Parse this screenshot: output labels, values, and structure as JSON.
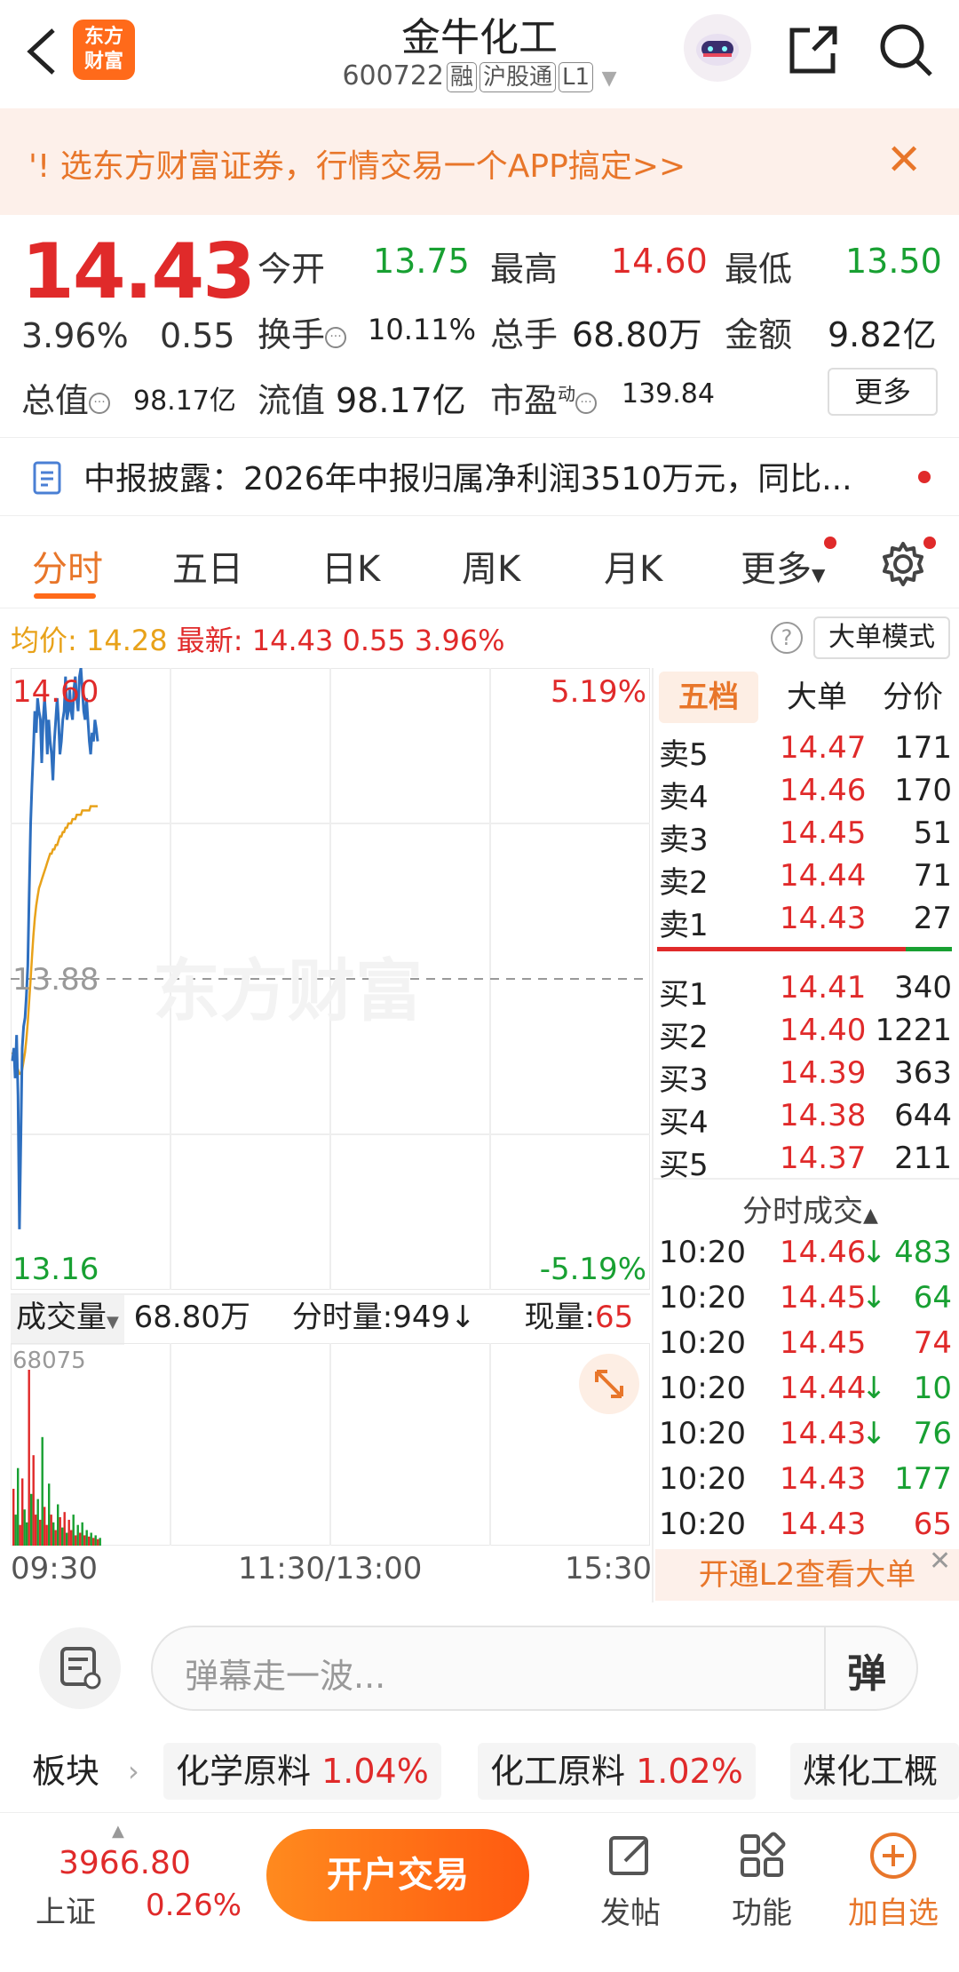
{
  "header": {
    "logo_text_1": "东方",
    "logo_text_2": "财富",
    "title": "金牛化工",
    "code": "600722",
    "tags": [
      "融",
      "沪股通",
      "L1"
    ]
  },
  "banner": {
    "text": "选东方财富证券，行情交易一个APP搞定>>",
    "prefix": "'!"
  },
  "quote": {
    "price": "14.43",
    "change_pct": "3.96%",
    "change": "0.55",
    "open_label": "今开",
    "open": "13.75",
    "high_label": "最高",
    "high": "14.60",
    "low_label": "最低",
    "low": "13.50",
    "turnover_label": "换手",
    "turnover": "10.11%",
    "volume_label": "总手",
    "volume": "68.80万",
    "amount_label": "金额",
    "amount": "9.82亿",
    "mktcap_label": "总值",
    "mktcap": "98.17亿",
    "float_label": "流值",
    "float": "98.17亿",
    "pe_label": "市盈",
    "pe_sup": "动",
    "pe": "139.84",
    "more": "更多"
  },
  "report": {
    "text": "中报披露：2026年中报归属净利润3510万元，同比..."
  },
  "tabs": [
    "分时",
    "五日",
    "日K",
    "周K",
    "月K",
    "更多"
  ],
  "infobar": {
    "avg_label": "均价:",
    "avg": "14.28",
    "latest_label": "最新:",
    "latest": "14.43",
    "chg": "0.55",
    "pct": "3.96%",
    "bigmode": "大单模式"
  },
  "chart": {
    "top_price": "14.60",
    "mid_price": "13.88",
    "bottom_price": "13.16",
    "top_pct": "5.19%",
    "bottom_pct": "-5.19%",
    "watermark": "东方财富",
    "time_labels": [
      "09:30",
      "11:30/13:00",
      "15:30"
    ]
  },
  "chart_data": {
    "type": "line",
    "title": "",
    "series": [
      {
        "values": [
          13.69,
          13.72,
          13.65,
          13.75,
          13.61,
          13.3,
          13.5,
          13.72,
          13.77,
          13.79,
          13.84,
          13.91,
          14.08,
          14.24,
          14.33,
          14.41,
          14.5,
          14.45,
          14.53,
          14.5,
          14.48,
          14.38,
          14.48,
          14.53,
          14.48,
          14.4,
          14.48,
          14.43,
          14.4,
          14.34,
          14.43,
          14.48,
          14.53,
          14.48,
          14.4,
          14.43,
          14.48,
          14.5,
          14.58,
          14.48,
          14.5,
          14.55,
          14.5,
          14.48,
          14.55,
          14.58,
          14.53,
          14.5,
          14.58,
          14.6,
          14.55,
          14.5,
          14.48,
          14.53,
          14.48,
          14.43,
          14.4,
          14.45,
          14.43,
          14.48,
          14.46,
          14.43
        ]
      },
      {
        "values": [
          13.71,
          13.7,
          13.69,
          13.68,
          13.67,
          13.66,
          13.66,
          13.67,
          13.69,
          13.71,
          13.74,
          13.78,
          13.83,
          13.88,
          13.93,
          13.98,
          14.02,
          14.05,
          14.07,
          14.09,
          14.1,
          14.11,
          14.12,
          14.13,
          14.14,
          14.15,
          14.16,
          14.17,
          14.17,
          14.18,
          14.18,
          14.19,
          14.19,
          14.2,
          14.21,
          14.21,
          14.22,
          14.22,
          14.23,
          14.23,
          14.24,
          14.24,
          14.24,
          14.25,
          14.25,
          14.25,
          14.26,
          14.26,
          14.26,
          14.26,
          14.27,
          14.27,
          14.27,
          14.27,
          14.27,
          14.27,
          14.28,
          14.28,
          14.28,
          14.28,
          14.28,
          14.28
        ]
      }
    ],
    "ylim": [
      13.16,
      14.6
    ],
    "volume": {
      "label": "成交量",
      "total": "68.80万",
      "tick_label": "分时量:949",
      "current_label": "现量:",
      "current": "65",
      "max_label": "68075",
      "max": 68075,
      "bars": [
        22000,
        12000,
        30000,
        8000,
        26000,
        14000,
        9000,
        68075,
        20000,
        35000,
        12000,
        18000,
        10000,
        42000,
        15000,
        8000,
        24000,
        12000,
        9000,
        6000,
        16000,
        11000,
        7000,
        13000,
        5000,
        10000,
        6000,
        12000,
        4000,
        8000,
        5000,
        9000,
        4000,
        6000,
        3500,
        5000,
        3000,
        4000,
        2500,
        3000
      ],
      "bar_colors": [
        "red",
        "green",
        "green",
        "red",
        "red",
        "green",
        "green",
        "red",
        "green",
        "red",
        "red",
        "green",
        "red",
        "green",
        "red",
        "red",
        "green",
        "red",
        "green",
        "red",
        "green",
        "red",
        "green",
        "red",
        "green",
        "red",
        "red",
        "green",
        "red",
        "green",
        "red",
        "green",
        "red",
        "green",
        "red",
        "green",
        "red",
        "green",
        "red",
        "green"
      ]
    }
  },
  "orderbook": {
    "tabs": [
      "五档",
      "大单",
      "分价"
    ],
    "sells": [
      {
        "label": "卖5",
        "price": "14.47",
        "vol": "171"
      },
      {
        "label": "卖4",
        "price": "14.46",
        "vol": "170"
      },
      {
        "label": "卖3",
        "price": "14.45",
        "vol": "51"
      },
      {
        "label": "卖2",
        "price": "14.44",
        "vol": "71"
      },
      {
        "label": "卖1",
        "price": "14.43",
        "vol": "27"
      }
    ],
    "buys": [
      {
        "label": "买1",
        "price": "14.41",
        "vol": "340"
      },
      {
        "label": "买2",
        "price": "14.40",
        "vol": "1221"
      },
      {
        "label": "买3",
        "price": "14.39",
        "vol": "363"
      },
      {
        "label": "买4",
        "price": "14.38",
        "vol": "644"
      },
      {
        "label": "买5",
        "price": "14.37",
        "vol": "211"
      }
    ]
  },
  "trades": {
    "title": "分时成交",
    "rows": [
      {
        "time": "10:20",
        "price": "14.46",
        "arrow": "↓",
        "vol": "483"
      },
      {
        "time": "10:20",
        "price": "14.45",
        "arrow": "↓",
        "vol": "64"
      },
      {
        "time": "10:20",
        "price": "14.45",
        "arrow": "",
        "vol": "74"
      },
      {
        "time": "10:20",
        "price": "14.44",
        "arrow": "↓",
        "vol": "10"
      },
      {
        "time": "10:20",
        "price": "14.43",
        "arrow": "↓",
        "vol": "76"
      },
      {
        "time": "10:20",
        "price": "14.43",
        "arrow": "",
        "vol": "177"
      },
      {
        "time": "10:20",
        "price": "14.43",
        "arrow": "",
        "vol": "65"
      }
    ],
    "l2_button": "开通L2查看大单"
  },
  "danmaku": {
    "placeholder": "弹幕走一波...",
    "send": "弹"
  },
  "sectors": {
    "label": "板块",
    "items": [
      {
        "name": "化学原料",
        "pct": "1.04%"
      },
      {
        "name": "化工原料",
        "pct": "1.02%"
      },
      {
        "name": "煤化工概",
        "pct": ""
      }
    ]
  },
  "bottom": {
    "index_value": "3966.80",
    "index_name": "上证",
    "index_pct": "0.26%",
    "open_account": "开户交易",
    "post": "发帖",
    "function": "功能",
    "watchlist": "加自选"
  }
}
